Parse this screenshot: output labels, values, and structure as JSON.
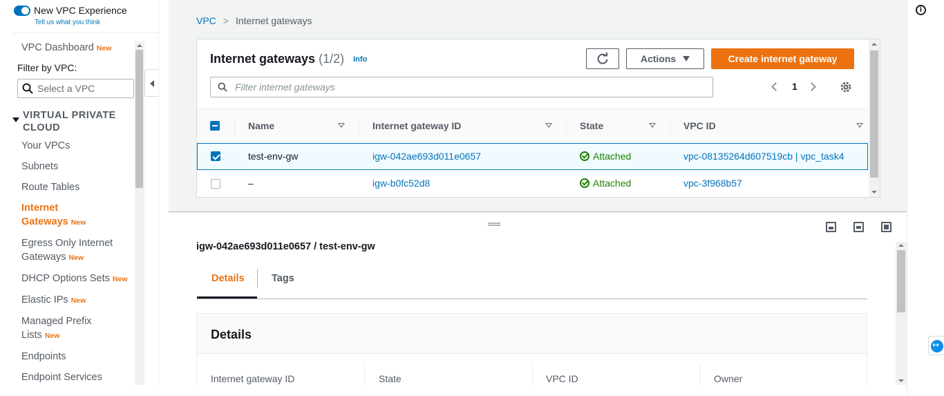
{
  "sidebar": {
    "new_experience": {
      "title": "New VPC Experience",
      "subtitle": "Tell us what you think"
    },
    "dashboard": "VPC Dashboard",
    "new_badge": "New",
    "filter_label": "Filter by VPC:",
    "filter_placeholder": "Select a VPC",
    "section": "VIRTUAL PRIVATE CLOUD",
    "items": [
      {
        "label": "Your VPCs"
      },
      {
        "label": "Subnets"
      },
      {
        "label": "Route Tables"
      },
      {
        "label": "Internet Gateways"
      },
      {
        "label": "Egress Only Internet Gateways"
      },
      {
        "label": "DHCP Options Sets"
      },
      {
        "label": "Elastic IPs"
      },
      {
        "label": "Managed Prefix Lists"
      },
      {
        "label": "Endpoints"
      },
      {
        "label": "Endpoint Services"
      }
    ]
  },
  "breadcrumb": {
    "root": "VPC",
    "current": "Internet gateways"
  },
  "panel": {
    "title": "Internet gateways",
    "count": "(1/2)",
    "info": "Info",
    "actions": "Actions",
    "create": "Create internet gateway",
    "filter_placeholder": "Filter internet gateways",
    "page": "1",
    "columns": [
      "Name",
      "Internet gateway ID",
      "State",
      "VPC ID"
    ],
    "rows": [
      {
        "name": "test-env-gw",
        "id": "igw-042ae693d011e0657",
        "state": "Attached",
        "vpc": "vpc-08135264d607519cb | vpc_task4",
        "selected": true
      },
      {
        "name": "–",
        "id": "igw-b0fc52d8",
        "state": "Attached",
        "vpc": "vpc-3f968b57",
        "selected": false
      }
    ]
  },
  "details": {
    "title": "igw-042ae693d011e0657 / test-env-gw",
    "tabs": [
      "Details",
      "Tags"
    ],
    "box_title": "Details",
    "fields": [
      "Internet gateway ID",
      "State",
      "VPC ID",
      "Owner"
    ]
  },
  "icons": [
    "search-icon",
    "refresh-icon",
    "settings-gear-icon",
    "info-icon",
    "check-circle-icon",
    "teamviewer-icon"
  ],
  "colors": {
    "accent": "#ec7211",
    "link": "#0073bb",
    "success": "#1d8102"
  }
}
